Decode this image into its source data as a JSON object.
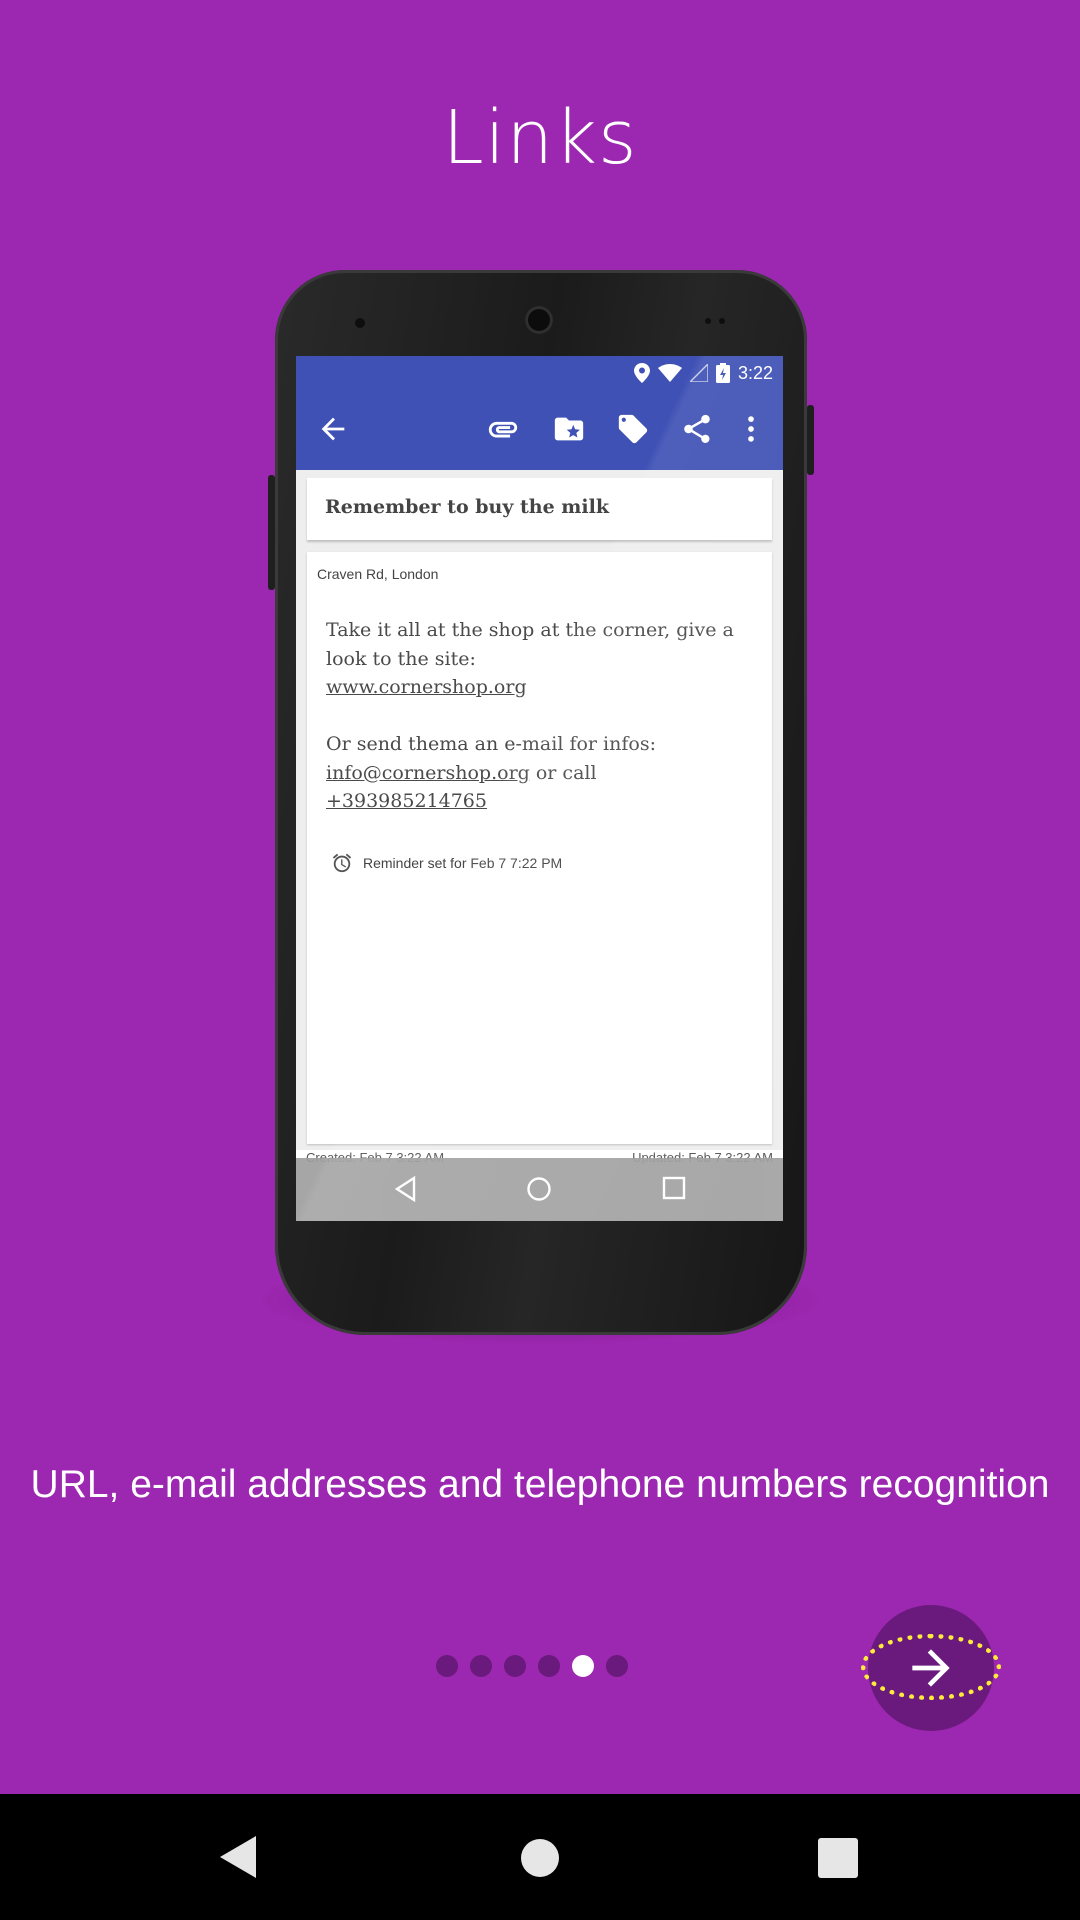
{
  "page": {
    "title": "Links",
    "caption": "URL, e-mail addresses and telephone numbers recognition",
    "pager": {
      "total": 6,
      "active_index": 4
    },
    "colors": {
      "background": "#9c27b0",
      "dot_inactive": "#6a1a7c",
      "dot_active": "#ffffff",
      "next_button": "#6a1a7c",
      "focus_ring": "#ffeb3b"
    }
  },
  "phone_screen": {
    "status_time": "3:22",
    "appbar_icons": [
      "back-arrow-icon",
      "paperclip-icon",
      "folder-star-icon",
      "tag-icon",
      "share-icon",
      "more-vert-icon"
    ],
    "note_title": "Remember to buy the milk",
    "location": "Craven Rd, London",
    "body_line1": "Take it all at the shop at the corner, give a look to the site:",
    "body_url": "www.cornershop.org",
    "body_line2": "Or send thema an e-mail for infos:",
    "body_email": "info@cornershop.org",
    "body_or_call": " or call",
    "body_phone": "+393985214765",
    "reminder": "Reminder set for Feb 7 7:22 PM",
    "created": "Created: Feb 7 3:22 AM",
    "updated": "Updated: Feb 7 3:22 AM",
    "colors": {
      "appbar": "#3f51b5"
    }
  },
  "system_nav": {
    "icons": [
      "back-icon",
      "home-icon",
      "recents-icon"
    ]
  }
}
